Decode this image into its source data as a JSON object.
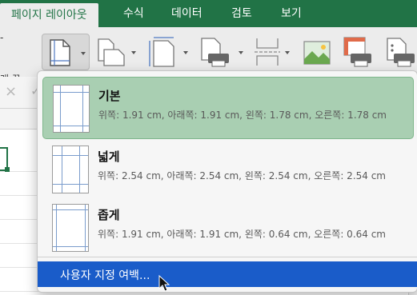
{
  "tabs": [
    "페이지 레이아웃",
    "수식",
    "데이터",
    "검토",
    "보기"
  ],
  "ribbon": {
    "left_fragment": "래 끌",
    "tool_icons": [
      "margins-icon",
      "orientation-icon",
      "size-icon",
      "print-area-icon",
      "breaks-icon",
      "background-icon",
      "print-titles-icon",
      "page-setup-icon"
    ]
  },
  "formula_bar": {
    "cancel_glyph": "×",
    "confirm_glyph": "✓"
  },
  "menu": {
    "items": [
      {
        "title": "기본",
        "desc": "위쪽: 1.91 cm, 아래쪽: 1.91 cm, 왼쪽: 1.78 cm, 오른쪽: 1.78 cm",
        "selected": true
      },
      {
        "title": "넓게",
        "desc": "위쪽: 2.54 cm, 아래쪽: 2.54 cm, 왼쪽: 2.54 cm, 오른쪽: 2.54 cm",
        "selected": false
      },
      {
        "title": "좁게",
        "desc": "위쪽: 1.91 cm, 아래쪽: 1.91 cm, 왼쪽: 0.64 cm, 오른쪽: 0.64 cm",
        "selected": false
      }
    ],
    "custom_label": "사용자 지정 여백..."
  },
  "colors": {
    "excel_green": "#217346",
    "selected_item": "#a9cfb2",
    "custom_highlight": "#1a5cc9"
  }
}
